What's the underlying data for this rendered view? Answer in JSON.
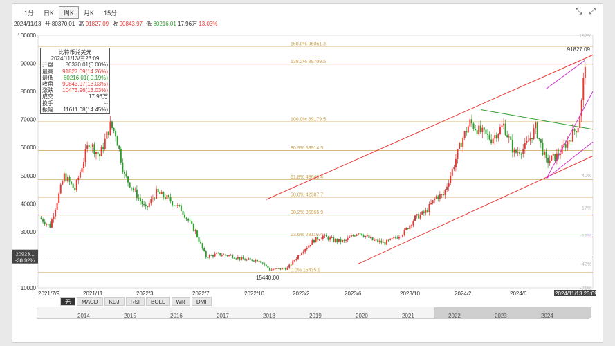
{
  "tabs": [
    {
      "label": "1分",
      "active": false
    },
    {
      "label": "日K",
      "active": false
    },
    {
      "label": "周K",
      "active": true
    },
    {
      "label": "月K",
      "active": false
    },
    {
      "label": "15分",
      "active": false
    }
  ],
  "header": {
    "date": "2024/11/13",
    "open_label": "开",
    "open": "80370.01",
    "high_label": "高",
    "high": "91827.09",
    "close_label": "收",
    "close": "90843.97",
    "low_label": "低",
    "low": "80216.01",
    "vol": "17.96万",
    "pct": "13.03%"
  },
  "tooltip": {
    "title": "比特币兑美元",
    "date": "2024/11/13/三23:09",
    "rows": [
      {
        "label": "开盘",
        "value": "80370.01(0.00%)",
        "color": "#333"
      },
      {
        "label": "最高",
        "value": "91827.09(14.26%)",
        "color": "#e53935"
      },
      {
        "label": "最低",
        "value": "80216.01(-0.19%)",
        "color": "#2e9d2e"
      },
      {
        "label": "收盘",
        "value": "90843.97(13.03%)",
        "color": "#e53935"
      },
      {
        "label": "涨跌",
        "value": "10473.96(13.03%)",
        "color": "#e53935"
      },
      {
        "label": "成交",
        "value": "17.96万",
        "color": "#333"
      },
      {
        "label": "换手",
        "value": "--",
        "color": "#333"
      },
      {
        "label": "振幅",
        "value": "11611.08(14.45%)",
        "color": "#333"
      }
    ]
  },
  "chart_data": {
    "type": "candlestick",
    "title": "比特币兑美元",
    "y_ticks": [
      100000,
      90000,
      80000,
      70000,
      60000,
      50000,
      40000,
      30000,
      20000,
      10000
    ],
    "ylim": [
      10000,
      100000
    ],
    "right_pct_ticks": [
      "192%",
      "40%",
      "17%",
      "-12%",
      "-42%",
      "-71%"
    ],
    "x_ticks": [
      "2021/7/9",
      "2021/11",
      "2022/3",
      "2022/7",
      "2022/10",
      "2023/2",
      "2023/6",
      "2023/10",
      "2024/2",
      "2024/6",
      "2024/11/13 23:09"
    ],
    "fib_levels": [
      {
        "label": "150.0% 96051.3",
        "value": 96051.3
      },
      {
        "label": "138.2% 89709.5",
        "value": 89709.5
      },
      {
        "label": "100.0% 69179.5",
        "value": 69179.5
      },
      {
        "label": "80.9% 58914.5",
        "value": 58914.5
      },
      {
        "label": "61.8% 48649.4",
        "value": 48649.4
      },
      {
        "label": "50.0% 42307.7",
        "value": 42307.7
      },
      {
        "label": "38.2% 35965.9",
        "value": 35965.9
      },
      {
        "label": "23.6% 28119.4",
        "value": 28119.4
      },
      {
        "label": "0.0% 15435.9",
        "value": 15435.9
      }
    ],
    "crosshair_value": "20923.1",
    "crosshair_pct": "-38.92%",
    "max_label": "91827.09",
    "min_label": "15440.00",
    "anchors": [
      [
        0,
        35000
      ],
      [
        6,
        32000
      ],
      [
        14,
        50000
      ],
      [
        20,
        45000
      ],
      [
        28,
        62000
      ],
      [
        34,
        57000
      ],
      [
        40,
        68000
      ],
      [
        43,
        65000
      ],
      [
        48,
        50000
      ],
      [
        55,
        43000
      ],
      [
        60,
        38000
      ],
      [
        66,
        44000
      ],
      [
        72,
        42000
      ],
      [
        80,
        38000
      ],
      [
        88,
        30000
      ],
      [
        94,
        21000
      ],
      [
        100,
        22000
      ],
      [
        108,
        21500
      ],
      [
        116,
        20000
      ],
      [
        124,
        20000
      ],
      [
        130,
        16500
      ],
      [
        136,
        16800
      ],
      [
        140,
        17000
      ],
      [
        148,
        23000
      ],
      [
        155,
        27000
      ],
      [
        160,
        28500
      ],
      [
        166,
        27000
      ],
      [
        172,
        26500
      ],
      [
        180,
        30000
      ],
      [
        188,
        27000
      ],
      [
        195,
        26000
      ],
      [
        200,
        27500
      ],
      [
        206,
        30000
      ],
      [
        212,
        35000
      ],
      [
        218,
        37000
      ],
      [
        224,
        42500
      ],
      [
        228,
        43000
      ],
      [
        233,
        52000
      ],
      [
        238,
        62000
      ],
      [
        243,
        69000
      ],
      [
        248,
        66000
      ],
      [
        255,
        63000
      ],
      [
        262,
        68000
      ],
      [
        268,
        58000
      ],
      [
        274,
        60000
      ],
      [
        280,
        67000
      ],
      [
        286,
        55000
      ],
      [
        292,
        57000
      ],
      [
        298,
        62000
      ],
      [
        304,
        68000
      ],
      [
        306,
        76000
      ],
      [
        308,
        90844
      ]
    ],
    "categories_labels_bottom": [
      "2014",
      "2015",
      "2016",
      "2017",
      "2018",
      "2019",
      "2020",
      "2021",
      "2022",
      "2023",
      "2024"
    ]
  },
  "indicator_tabs": [
    {
      "label": "无",
      "active": true
    },
    {
      "label": "MACD",
      "active": false
    },
    {
      "label": "KDJ",
      "active": false
    },
    {
      "label": "RSI",
      "active": false
    },
    {
      "label": "BOLL",
      "active": false
    },
    {
      "label": "WR",
      "active": false
    },
    {
      "label": "DMI",
      "active": false
    }
  ],
  "colors": {
    "up": "#e53935",
    "down": "#2e9d2e",
    "fib": "#c8a24e",
    "channel": "#e53935",
    "fan": "#cc33cc",
    "triangle": "#2e9d2e"
  }
}
